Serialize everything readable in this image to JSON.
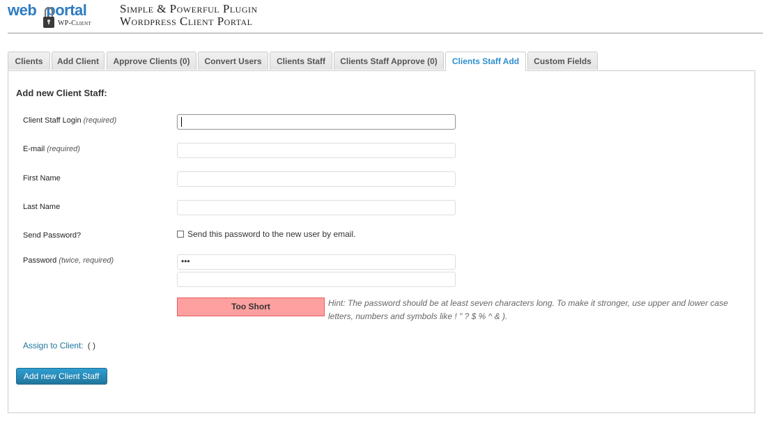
{
  "header": {
    "logo_web": "web",
    "logo_portal": "portal",
    "logo_sub": "WP-Client",
    "tagline_line1": "Simple & Powerful Plugin",
    "tagline_line2": "Wordpress Client Portal",
    "brand_color": "#2d7cc1"
  },
  "tabs": [
    {
      "label": "Clients",
      "active": false
    },
    {
      "label": "Add Client",
      "active": false
    },
    {
      "label": "Approve Clients (0)",
      "active": false
    },
    {
      "label": "Convert Users",
      "active": false
    },
    {
      "label": "Clients Staff",
      "active": false
    },
    {
      "label": "Clients Staff Approve (0)",
      "active": false
    },
    {
      "label": "Clients Staff Add",
      "active": true
    },
    {
      "label": "Custom Fields",
      "active": false
    }
  ],
  "form": {
    "title": "Add new Client Staff:",
    "login_label": "Client Staff Login",
    "login_note": "(required)",
    "login_value": "",
    "email_label": "E-mail",
    "email_note": "(required)",
    "email_value": "",
    "first_name_label": "First Name",
    "first_name_value": "",
    "last_name_label": "Last Name",
    "last_name_value": "",
    "send_password_label": "Send Password?",
    "send_password_checkbox_text": "Send this password to the new user by email.",
    "send_password_checked": false,
    "password_label": "Password",
    "password_note": "(twice, required)",
    "password_masked": "•••",
    "password_confirm_value": "",
    "strength_text": "Too Short",
    "strength_color": "#ffa0a0",
    "hint_text": "Hint: The password should be at least seven characters long. To make it stronger, use upper and lower case letters, numbers and symbols like ! \" ? $ % ^ & ).",
    "assign_link": "Assign to Client:",
    "assign_value": "( )",
    "submit_label": "Add new Client Staff",
    "accent_color": "#21759b"
  }
}
